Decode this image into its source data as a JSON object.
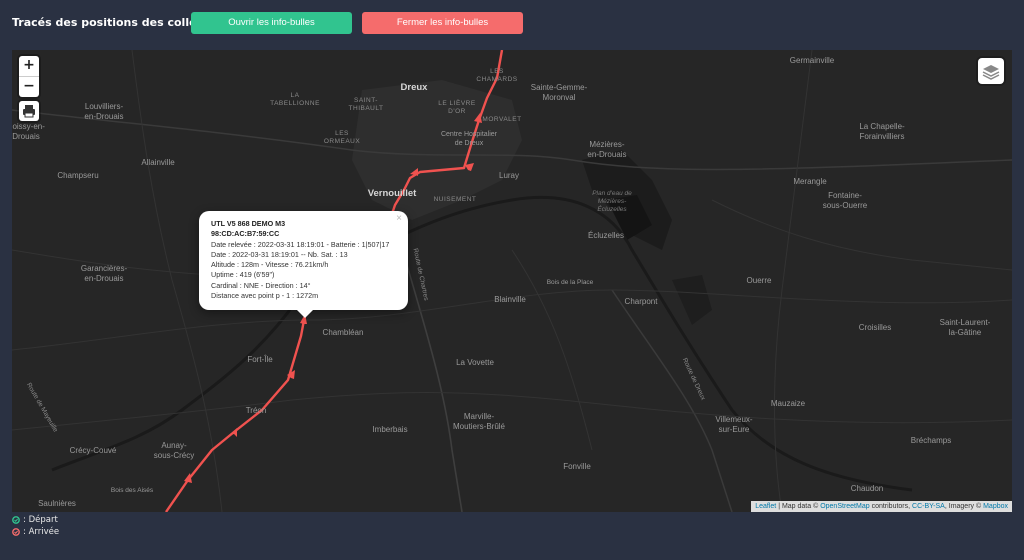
{
  "header": {
    "title": "Tracés des positions des collecteurs",
    "open_button": "Ouvrir les info-bulles",
    "close_button": "Fermer les info-bulles",
    "open_color": "#31c48f",
    "close_color": "#f56c6c"
  },
  "map": {
    "zoom_in": "+",
    "zoom_out": "−",
    "track_color": "#f0524f",
    "places": {
      "dreux": "Dreux",
      "vernouillet": "Vernouillet",
      "les_chamards": "LES\nCHAMARDS",
      "tabellionne": "LA\nTABELLIONNE",
      "saint_thibault": "SAINT-\nTHIBAULT",
      "le_lievre_dor": "LE LIÈVRE\nD'OR",
      "morvalet": "MORVALET",
      "les_ormeaux": "LES\nORMEAUX",
      "centre_hospitalier": "Centre Hospitalier\nde Dreux",
      "nuisement": "NUISEMENT",
      "luray": "Luray",
      "sainte_gemme": "Sainte-Gemme-\nMoronval",
      "germainville": "Germainville",
      "louvilliers": "Louvilliers-\nen-Drouais",
      "boissy": "Boissy-en-\nDrouais",
      "allainville": "Allainville",
      "champseru": "Champseru",
      "garancieres": "Garancières-\nen-Drouais",
      "mezieres": "Mézières-\nen-Drouais",
      "plan_deau": "Plan d'eau de\nMézières-\nÉcluzelles",
      "ecluzelles": "Écluzelles",
      "la_chapelle": "La Chapelle-\nForainvilliers",
      "merangle": "Merangle",
      "fontaine": "Fontaine-\nsous-Ouerre",
      "ouerre": "Ouerre",
      "bois_place": "Bois de la Place",
      "blainville": "Blainville",
      "charpont": "Charpont",
      "chambleau": "Chambléan",
      "fort_ile": "Fort-Île",
      "la_vovette": "La Vovette",
      "croisilles": "Croisilles",
      "saint_laurent": "Saint-Laurent-\nla-Gâtine",
      "treon": "Tréon",
      "mauzaize": "Mauzaize",
      "villemeux": "Villemeux-\nsur-Eure",
      "marville": "Marville-\nMoutiers-Brûlé",
      "imberbais": "Imberbais",
      "aunay": "Aunay-\nsous-Crécy",
      "crecy": "Crécy-Couvé",
      "brechamps": "Bréchamps",
      "fonville": "Fonville",
      "saulnieres": "Saulnières",
      "bois_aises": "Bois des Aisés",
      "chaudon": "Chaudon"
    },
    "roads": {
      "route_chartres": "Route de Chartres",
      "route_dreux": "Route de Dreux",
      "route_mayeuille": "Route de Mayeuille"
    }
  },
  "popup": {
    "title": "UTL V5 868 DEMO M3",
    "mac": "98:CD:AC:B7:59:CC",
    "line1": "Date relevée : 2022-03-31 18:19:01 - Batterie : 1|507|17",
    "line2": "Date : 2022-03-31 18:19:01 -- Nb. Sat. : 13",
    "line3": "Altitude : 128m - Vitesse : 76.21km/h",
    "line4": "Uptime : 419 (6'59\")",
    "line5": "Cardinal : NNE - Direction : 14°",
    "line6": "Distance avec point p - 1 : 1272m",
    "close": "×"
  },
  "attribution": {
    "leaflet": "Leaflet",
    "sep": " | Map data © ",
    "osm": "OpenStreetMap",
    "contrib": " contributors, ",
    "license": "CC-BY-SA",
    "imagery": ", Imagery © ",
    "mapbox": "Mapbox"
  },
  "legend": {
    "depart": ": Départ",
    "arrivee": ": Arrivée",
    "depart_color": "#31c48f",
    "arrivee_color": "#f56c6c"
  }
}
